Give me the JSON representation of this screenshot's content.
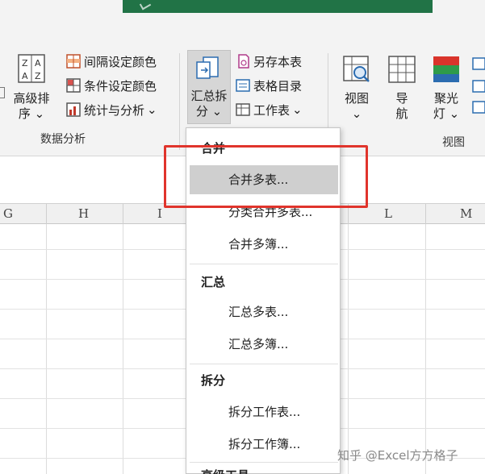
{
  "ribbon": {
    "data_group": {
      "label": "数据分析",
      "sort_button": {
        "line1": "高级排",
        "line2": "序",
        "dropdown": "⌄"
      },
      "items": [
        {
          "label": "间隔设定颜色"
        },
        {
          "label": "条件设定颜色"
        },
        {
          "label": "统计与分析",
          "dropdown": "⌄"
        }
      ]
    },
    "summary_button": {
      "line1": "汇总拆",
      "line2": "分",
      "dropdown": "⌄"
    },
    "middle_items": [
      {
        "label": "另存本表"
      },
      {
        "label": "表格目录"
      },
      {
        "label": "工作表",
        "dropdown": "⌄"
      }
    ],
    "view_group": {
      "label": "视图",
      "buttons": [
        {
          "line1": "视图",
          "line2": "⌄"
        },
        {
          "line1": "导",
          "line2": "航"
        },
        {
          "line1": "聚光",
          "line2": "灯 ⌄"
        }
      ]
    }
  },
  "columns": [
    "G",
    "H",
    "I",
    "L",
    "M"
  ],
  "menu": {
    "sections": [
      {
        "title": "合并",
        "items": [
          "合并多表...",
          "分类合并多表...",
          "合并多簿..."
        ]
      },
      {
        "title": "汇总",
        "items": [
          "汇总多表...",
          "汇总多簿..."
        ]
      },
      {
        "title": "拆分",
        "items": [
          "拆分工作表...",
          "拆分工作簿..."
        ]
      },
      {
        "title": "高级工具"
      }
    ],
    "highlighted_item": "合并多表..."
  },
  "watermark": "知乎 @Excel方方格子",
  "colors": {
    "excel_green": "#217346",
    "highlight_box": "#e0342c",
    "menu_highlight": "#cfcfcf"
  }
}
